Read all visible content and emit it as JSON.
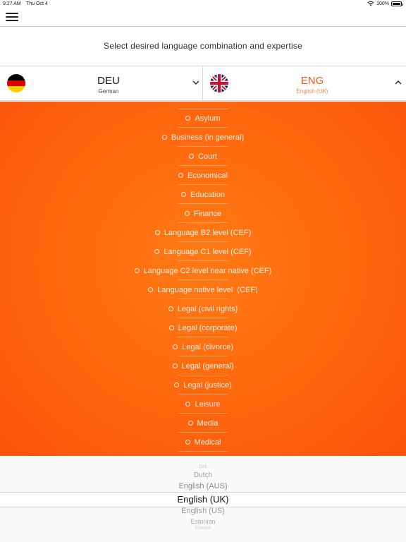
{
  "status_bar": {
    "time": "9:27 AM",
    "date": "Thu Oct 4",
    "battery": "100%"
  },
  "instruction": "Select desired language combination and expertise",
  "source_language": {
    "code": "DEU",
    "name": "German"
  },
  "target_language": {
    "code": "ENG",
    "name": "English (UK)"
  },
  "expertise": [
    "Asylum",
    "Business (in general)",
    "Court",
    "Economical",
    "Education",
    "Finance",
    "Language B2 level (CEF)",
    "Language C1 level (CEF)",
    "Language C2 level near native (CEF)",
    "Language native level  (CEF)",
    "Legal (civil rights)",
    "Legal (corporate)",
    "Legal (divorce)",
    "Legal (general)",
    "Legal (justice)",
    "Leisure",
    "Media",
    "Medical"
  ],
  "picker": {
    "options": [
      "Dari",
      "Dutch",
      "English (AUS)",
      "English (UK)",
      "English (US)",
      "Estonian",
      "Finnish"
    ],
    "selected": "English (UK)"
  },
  "colors": {
    "accent": "#f05a12",
    "panel": "#ff6a0e"
  }
}
